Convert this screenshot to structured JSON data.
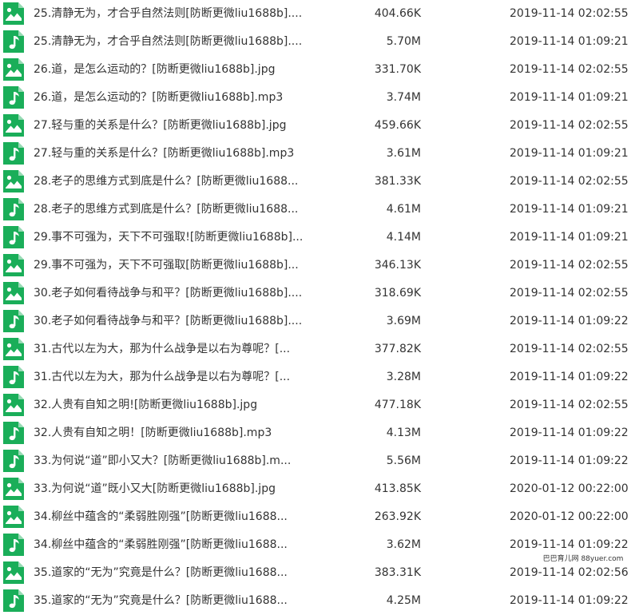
{
  "colors": {
    "icon_green": "#1aae59",
    "text": "#333333",
    "background": "#ffffff"
  },
  "files": [
    {
      "icon": "image-file-icon",
      "name": "25.清静无为，才合乎自然法则[防断更微liu1688b]....",
      "size": "404.66K",
      "date": "2019-11-14 02:02:55"
    },
    {
      "icon": "audio-file-icon",
      "name": "25.清静无为，才合乎自然法则[防断更微liu1688b]....",
      "size": "5.70M",
      "date": "2019-11-14 01:09:21"
    },
    {
      "icon": "image-file-icon",
      "name": "26.道，是怎么运动的？[防断更微liu1688b].jpg",
      "size": "331.70K",
      "date": "2019-11-14 02:02:55"
    },
    {
      "icon": "audio-file-icon",
      "name": "26.道，是怎么运动的？[防断更微liu1688b].mp3",
      "size": "3.74M",
      "date": "2019-11-14 01:09:21"
    },
    {
      "icon": "image-file-icon",
      "name": "27.轻与重的关系是什么？[防断更微liu1688b].jpg",
      "size": "459.66K",
      "date": "2019-11-14 02:02:55"
    },
    {
      "icon": "audio-file-icon",
      "name": "27.轻与重的关系是什么？[防断更微liu1688b].mp3",
      "size": "3.61M",
      "date": "2019-11-14 01:09:21"
    },
    {
      "icon": "image-file-icon",
      "name": "28.老子的思维方式到底是什么？[防断更微liu1688...",
      "size": "381.33K",
      "date": "2019-11-14 02:02:55"
    },
    {
      "icon": "audio-file-icon",
      "name": "28.老子的思维方式到底是什么？[防断更微liu1688...",
      "size": "4.61M",
      "date": "2019-11-14 01:09:21"
    },
    {
      "icon": "audio-file-icon",
      "name": "29.事不可强为，天下不可强取![防断更微liu1688b]...",
      "size": "4.14M",
      "date": "2019-11-14 01:09:21"
    },
    {
      "icon": "image-file-icon",
      "name": "29.事不可强为，天下不可强取[防断更微liu1688b]...",
      "size": "346.13K",
      "date": "2019-11-14 02:02:55"
    },
    {
      "icon": "image-file-icon",
      "name": "30.老子如何看待战争与和平？[防断更微liu1688b]....",
      "size": "318.69K",
      "date": "2019-11-14 02:02:55"
    },
    {
      "icon": "audio-file-icon",
      "name": "30.老子如何看待战争与和平？[防断更微liu1688b]....",
      "size": "3.69M",
      "date": "2019-11-14 01:09:22"
    },
    {
      "icon": "image-file-icon",
      "name": "31.古代以左为大，那为什么战争是以右为尊呢？[...",
      "size": "377.82K",
      "date": "2019-11-14 02:02:55"
    },
    {
      "icon": "audio-file-icon",
      "name": "31.古代以左为大，那为什么战争是以右为尊呢？[...",
      "size": "3.28M",
      "date": "2019-11-14 01:09:22"
    },
    {
      "icon": "image-file-icon",
      "name": "32.人贵有自知之明![防断更微liu1688b].jpg",
      "size": "477.18K",
      "date": "2019-11-14 02:02:55"
    },
    {
      "icon": "audio-file-icon",
      "name": "32.人贵有自知之明！[防断更微liu1688b].mp3",
      "size": "4.13M",
      "date": "2019-11-14 01:09:22"
    },
    {
      "icon": "audio-file-icon",
      "name": "33.为何说“道”即小又大？[防断更微liu1688b].m...",
      "size": "5.56M",
      "date": "2019-11-14 01:09:22"
    },
    {
      "icon": "image-file-icon",
      "name": "33.为何说“道”既小又大[防断更微liu1688b].jpg",
      "size": "413.85K",
      "date": "2020-01-12 00:22:00"
    },
    {
      "icon": "image-file-icon",
      "name": "34.柳丝中蕴含的“柔弱胜刚强”[防断更微liu1688...",
      "size": "263.92K",
      "date": "2020-01-12 00:22:00"
    },
    {
      "icon": "audio-file-icon",
      "name": "34.柳丝中蕴含的“柔弱胜刚强”[防断更微liu1688...",
      "size": "3.62M",
      "date": "2019-11-14 01:09:22"
    },
    {
      "icon": "image-file-icon",
      "name": "35.道家的“无为”究竟是什么？[防断更微liu1688...",
      "size": "383.31K",
      "date": "2019-11-14 02:02:56"
    },
    {
      "icon": "audio-file-icon",
      "name": "35.道家的“无为”究竟是什么？[防断更微liu1688...",
      "size": "4.25M",
      "date": "2019-11-14 01:09:22"
    }
  ],
  "watermark": "巴巴育儿网 88yuer.com"
}
